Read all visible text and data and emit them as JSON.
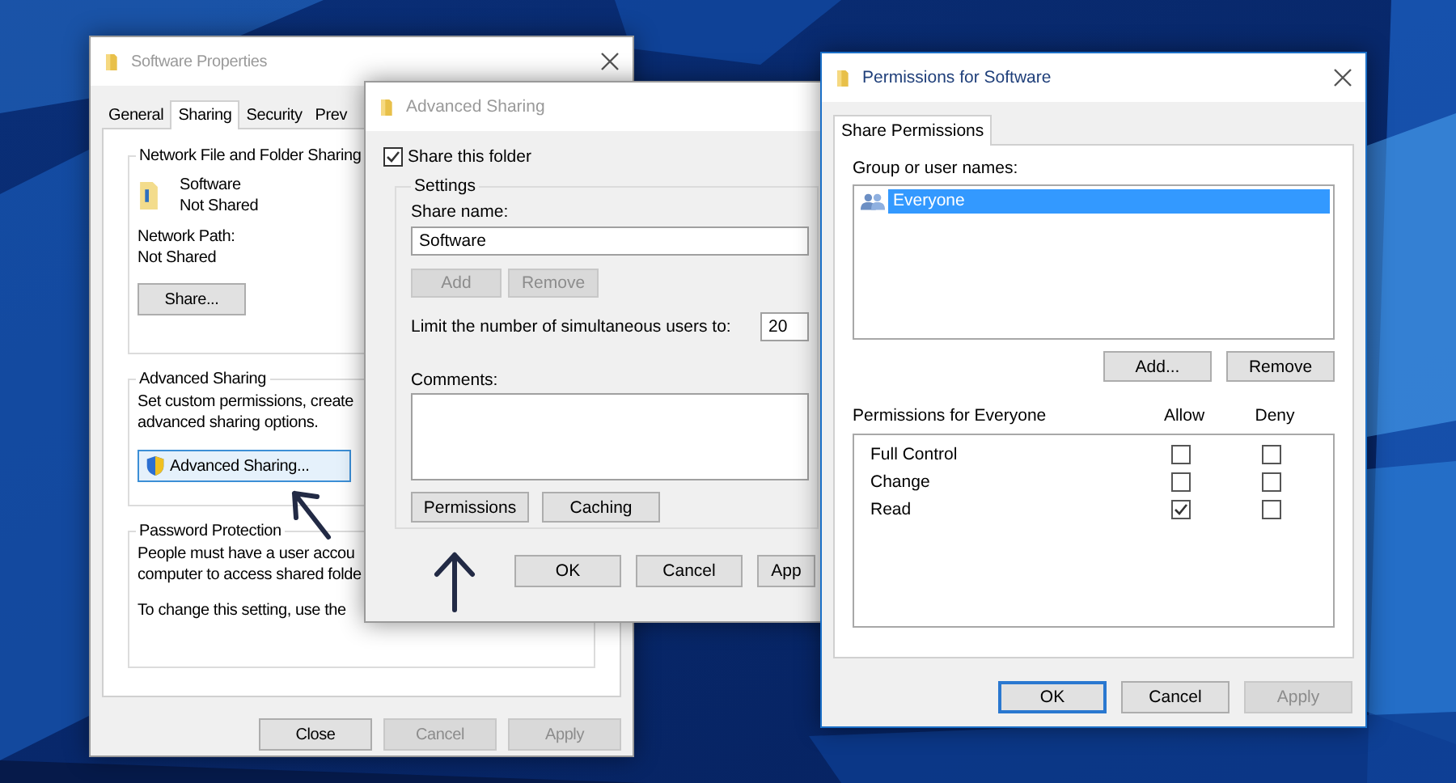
{
  "properties_window": {
    "title": "Software Properties",
    "active": false,
    "tabs": [
      {
        "label": "General",
        "selected": false
      },
      {
        "label": "Sharing",
        "selected": true
      },
      {
        "label": "Security",
        "selected": false
      },
      {
        "label": "Prev",
        "selected": false
      }
    ],
    "network_sharing": {
      "heading": "Network File and Folder Sharing",
      "name": "Software",
      "status": "Not Shared",
      "path_label": "Network Path:",
      "path": "Not Shared",
      "button": "Share..."
    },
    "advanced_sharing": {
      "heading": "Advanced Sharing",
      "description_lines": [
        "Set custom permissions, create",
        "advanced sharing options."
      ],
      "button": "Advanced Sharing..."
    },
    "password_protection": {
      "heading": "Password Protection",
      "description_lines": [
        "People must have a user accou",
        "computer to access shared folde"
      ],
      "note": "To change this setting, use the"
    },
    "buttons": [
      {
        "label": "Close",
        "disabled": false
      },
      {
        "label": "Cancel",
        "disabled": true
      },
      {
        "label": "Apply",
        "disabled": true
      }
    ]
  },
  "advanced_window": {
    "title": "Advanced Sharing",
    "active": false,
    "share_checkbox": {
      "label": "Share this folder",
      "checked": true
    },
    "settings_heading": "Settings",
    "share_name_label": "Share name:",
    "share_name": "Software",
    "name_buttons": [
      {
        "label": "Add",
        "disabled": true
      },
      {
        "label": "Remove",
        "disabled": true
      }
    ],
    "limit_label": "Limit the number of simultaneous users to:",
    "limit_value": "20",
    "comments_label": "Comments:",
    "settings_buttons": [
      {
        "label": "Permissions",
        "disabled": false
      },
      {
        "label": "Caching",
        "disabled": false
      }
    ],
    "buttons": [
      {
        "label": "OK",
        "disabled": false
      },
      {
        "label": "Cancel",
        "disabled": false
      },
      {
        "label": "App",
        "disabled": false
      }
    ]
  },
  "permissions_window": {
    "title": "Permissions for Software",
    "active": true,
    "tabs": [
      {
        "label": "Share Permissions",
        "selected": true
      }
    ],
    "group_label": "Group or user names:",
    "users": [
      {
        "name": "Everyone",
        "selected": true
      }
    ],
    "user_buttons": [
      {
        "label": "Add...",
        "disabled": false
      },
      {
        "label": "Remove",
        "disabled": false
      }
    ],
    "permissions_label": "Permissions for Everyone",
    "columns": [
      "Allow",
      "Deny"
    ],
    "permissions": [
      {
        "name": "Full Control",
        "allow": false,
        "deny": false
      },
      {
        "name": "Change",
        "allow": false,
        "deny": false
      },
      {
        "name": "Read",
        "allow": true,
        "deny": false
      }
    ],
    "buttons": [
      {
        "label": "OK",
        "disabled": false,
        "default": true
      },
      {
        "label": "Cancel",
        "disabled": false,
        "default": false
      },
      {
        "label": "Apply",
        "disabled": true,
        "default": false
      }
    ]
  }
}
